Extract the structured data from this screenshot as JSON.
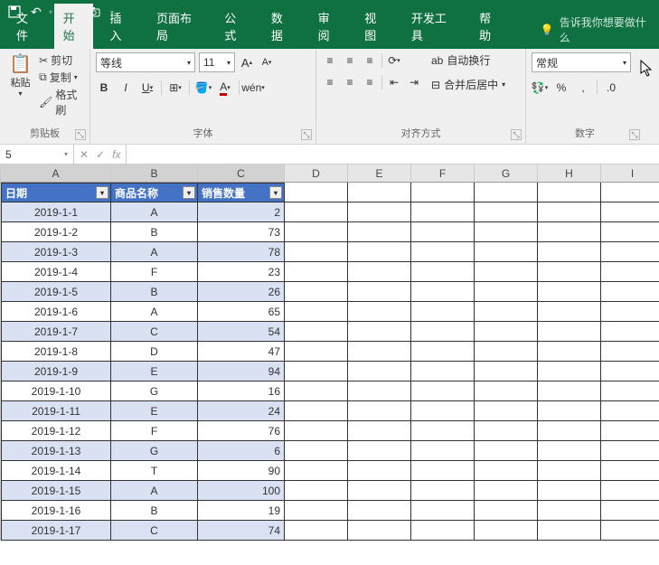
{
  "titlebar": {
    "undo": "↶",
    "redo": "↷"
  },
  "menu": {
    "file": "文件",
    "home": "开始",
    "insert": "插入",
    "layout": "页面布局",
    "formula": "公式",
    "data": "数据",
    "review": "审阅",
    "view": "视图",
    "dev": "开发工具",
    "help": "帮助",
    "tell": "告诉我你想要做什么"
  },
  "clip": {
    "group": "剪贴板",
    "paste": "粘贴",
    "cut": "剪切",
    "copy": "复制",
    "painter": "格式刷"
  },
  "font": {
    "group": "字体",
    "name": "等线",
    "size": "11",
    "bold": "B",
    "italic": "I",
    "underline": "U"
  },
  "align": {
    "group": "对齐方式",
    "wrap": "自动换行",
    "merge": "合并后居中"
  },
  "number": {
    "group": "数字",
    "format": "常规"
  },
  "fx": {
    "namebox": "5",
    "x": "✕",
    "check": "✓",
    "fx": "fx"
  },
  "cols": [
    "A",
    "B",
    "C",
    "D",
    "E",
    "F",
    "G",
    "H",
    "I"
  ],
  "headers": {
    "date": "日期",
    "product": "商品名称",
    "qty": "销售数量"
  },
  "rows": [
    {
      "d": "2019-1-1",
      "p": "A",
      "q": "2"
    },
    {
      "d": "2019-1-2",
      "p": "B",
      "q": "73"
    },
    {
      "d": "2019-1-3",
      "p": "A",
      "q": "78"
    },
    {
      "d": "2019-1-4",
      "p": "F",
      "q": "23"
    },
    {
      "d": "2019-1-5",
      "p": "B",
      "q": "26"
    },
    {
      "d": "2019-1-6",
      "p": "A",
      "q": "65"
    },
    {
      "d": "2019-1-7",
      "p": "C",
      "q": "54"
    },
    {
      "d": "2019-1-8",
      "p": "D",
      "q": "47"
    },
    {
      "d": "2019-1-9",
      "p": "E",
      "q": "94"
    },
    {
      "d": "2019-1-10",
      "p": "G",
      "q": "16"
    },
    {
      "d": "2019-1-11",
      "p": "E",
      "q": "24"
    },
    {
      "d": "2019-1-12",
      "p": "F",
      "q": "76"
    },
    {
      "d": "2019-1-13",
      "p": "G",
      "q": "6"
    },
    {
      "d": "2019-1-14",
      "p": "T",
      "q": "90"
    },
    {
      "d": "2019-1-15",
      "p": "A",
      "q": "100"
    },
    {
      "d": "2019-1-16",
      "p": "B",
      "q": "19"
    },
    {
      "d": "2019-1-17",
      "p": "C",
      "q": "74"
    }
  ]
}
